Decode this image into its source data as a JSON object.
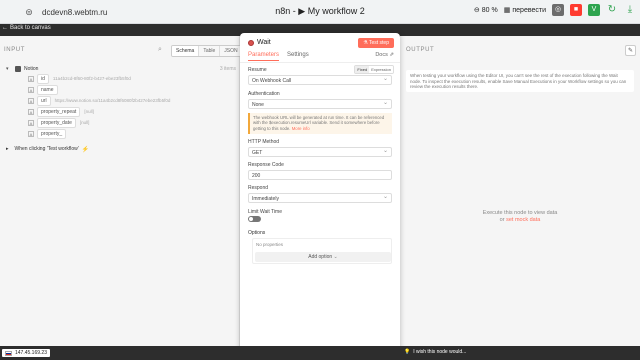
{
  "browser": {
    "url": "dcdevn8.webtm.ru",
    "tab_title": "n8n - ▶ My workflow 2",
    "zoom": "80 %",
    "translate_label": "перевести",
    "ext_colors": [
      "#6c6c6c",
      "#ff3b30",
      "#2ea44f",
      "#31a350"
    ]
  },
  "canvas": {
    "back_label": "Back to canvas"
  },
  "input_panel": {
    "header": "INPUT",
    "view_tabs": [
      "Schema",
      "Table",
      "JSON"
    ],
    "active_view": "Schema",
    "node_name": "Notion",
    "items_count": "3 items",
    "fields": [
      {
        "key": "id",
        "value": "11a4b2cd-8f60-80f2-b427-ebe23fb5f0d"
      },
      {
        "key": "name",
        "value": ""
      },
      {
        "key": "url",
        "value": "https://www.notion.so/11a4b2cd8f6080f2b427ebe23fb5f0d"
      },
      {
        "key": "property_repeat",
        "value": "[null]"
      },
      {
        "key": "property_date",
        "value": "[null]"
      },
      {
        "key": "property_",
        "value": ""
      }
    ],
    "trigger_label": "When clicking 'Test workflow'"
  },
  "node_panel": {
    "title": "Wait",
    "test_button": "Test step",
    "tabs": [
      "Parameters",
      "Settings"
    ],
    "active_tab": "Parameters",
    "docs_label": "Docs ⇗",
    "resume_label": "Resume",
    "fixed_label": "Fixed",
    "expression_label": "Expression",
    "resume_value": "On Webhook Call",
    "auth_label": "Authentication",
    "auth_value": "None",
    "notice_text": "The webhook URL will be generated at run time. It can be referenced with the $execution.resumeUrl variable. Send it somewhere before getting to this node.",
    "notice_link": "More info",
    "http_method_label": "HTTP Method",
    "http_method_value": "GET",
    "response_code_label": "Response Code",
    "response_code_value": "200",
    "respond_label": "Respond",
    "respond_value": "Immediately",
    "limit_label": "Limit Wait Time",
    "options_label": "Options",
    "no_properties": "No properties",
    "add_option": "Add option",
    "wish_text": "I wish this node would..."
  },
  "output_panel": {
    "header": "OUTPUT",
    "note": "When testing your workflow using the Editor UI, you can't see the rest of the execution following the Wait node. To inspect the execution results, enable Save Manual Executions in your Workflow settings so you can review the execution results there.",
    "empty_line": "Execute this node to view data",
    "or_label": "or",
    "mock_link": "set mock data"
  },
  "status_bar": {
    "ip": "147.45.169.23"
  }
}
